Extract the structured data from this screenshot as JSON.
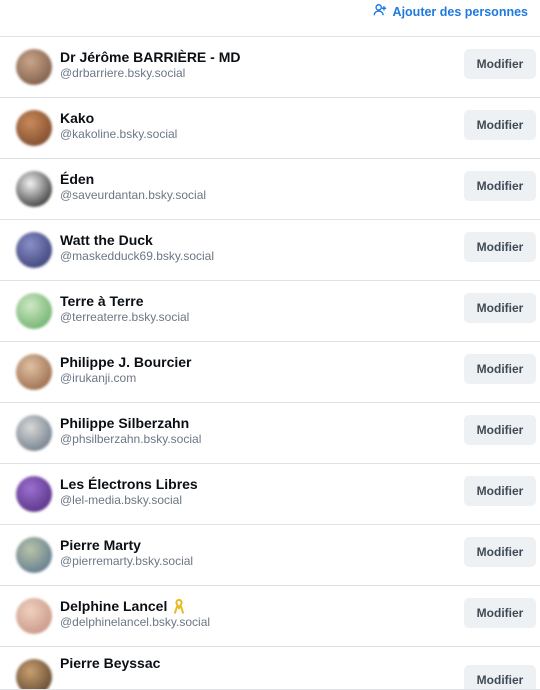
{
  "header": {
    "add_people_label": "Ajouter des personnes",
    "accent": "#1f7ae0"
  },
  "button_label": "Modifier",
  "members": [
    {
      "name": "Dr Jérôme BARRIÈRE - MD",
      "handle": "@drbarriere.bsky.social",
      "avatar_colors": [
        "#c9a58a",
        "#6f4d3a"
      ]
    },
    {
      "name": "Kako",
      "handle": "@kakoline.bsky.social",
      "avatar_colors": [
        "#c98a5a",
        "#6e3d22"
      ]
    },
    {
      "name": "Éden",
      "handle": "@saveurdantan.bsky.social",
      "avatar_colors": [
        "#f2f2f2",
        "#111111"
      ]
    },
    {
      "name": "Watt the Duck",
      "handle": "@maskedduck69.bsky.social",
      "avatar_colors": [
        "#8a8fc9",
        "#2c3366"
      ]
    },
    {
      "name": "Terre à Terre",
      "handle": "@terreaterre.bsky.social",
      "avatar_colors": [
        "#cfe8c4",
        "#5aa65a"
      ]
    },
    {
      "name": "Philippe J. Bourcier",
      "handle": "@irukanji.com",
      "avatar_colors": [
        "#e1c0a3",
        "#8a5a3a"
      ]
    },
    {
      "name": "Philippe Silberzahn",
      "handle": "@phsilberzahn.bsky.social",
      "avatar_colors": [
        "#d8d8d8",
        "#5b6b7a"
      ]
    },
    {
      "name": "Les Électrons Libres",
      "handle": "@lel-media.bsky.social",
      "avatar_colors": [
        "#9c6fd1",
        "#4a2673"
      ]
    },
    {
      "name": "Pierre Marty",
      "handle": "@pierremarty.bsky.social",
      "avatar_colors": [
        "#b8c4a8",
        "#4f6b8a"
      ]
    },
    {
      "name": "Delphine Lancel",
      "handle": "@delphinelancel.bsky.social",
      "avatar_colors": [
        "#f0d0c0",
        "#c08a7a"
      ],
      "badge": "yellow-ribbon-icon"
    },
    {
      "name": "Pierre Beyssac",
      "handle": "",
      "avatar_colors": [
        "#c9a070",
        "#4a3420"
      ]
    }
  ]
}
